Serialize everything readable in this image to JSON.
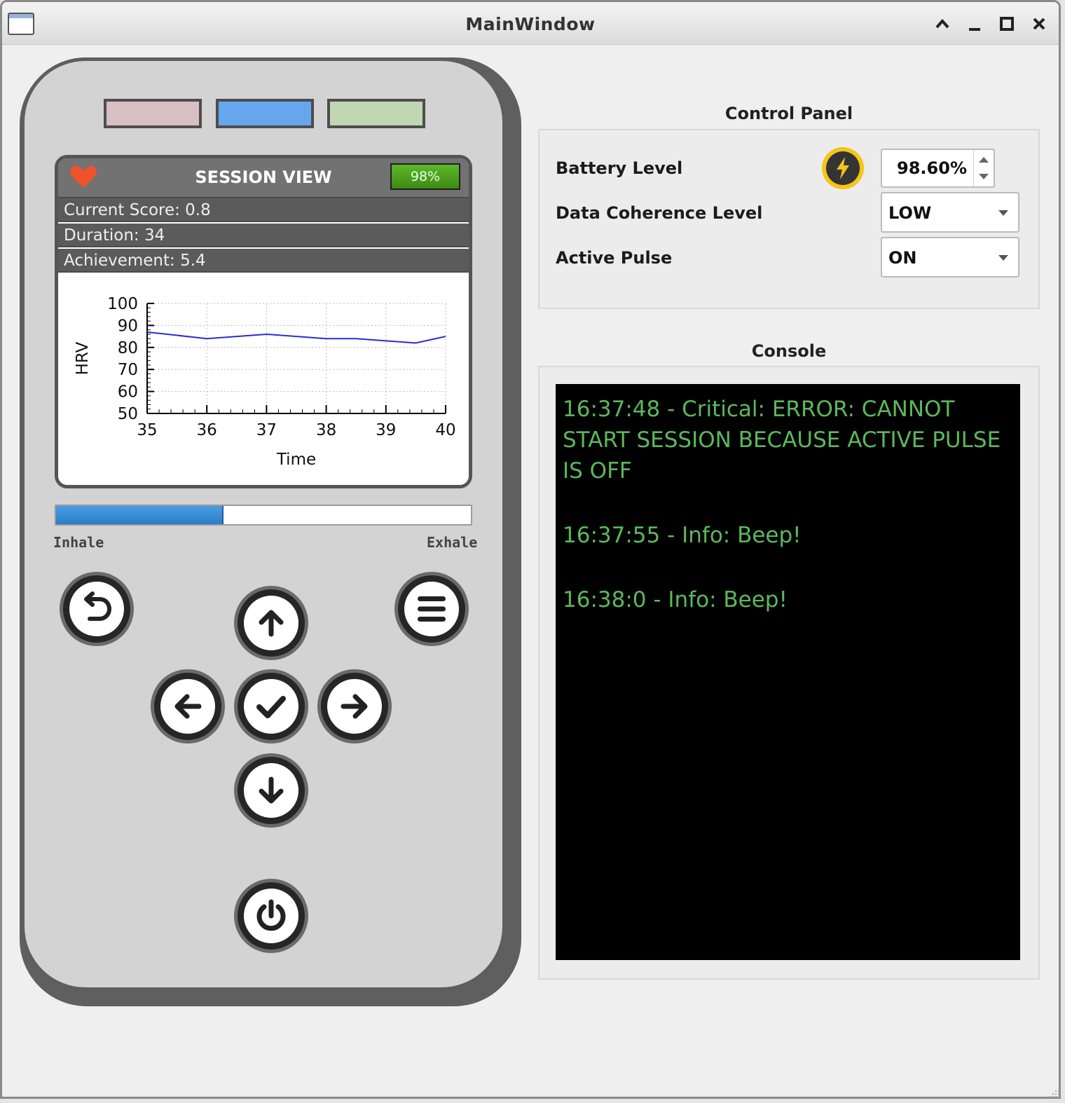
{
  "window": {
    "title": "MainWindow"
  },
  "device": {
    "leds": [
      {
        "color": "#d8bfc1"
      },
      {
        "color": "#66a6ee"
      },
      {
        "color": "#bfd7b2"
      }
    ],
    "screen": {
      "title": "SESSION VIEW",
      "battery_badge": "98%",
      "current_score": "Current Score: 0.8",
      "duration": "Duration: 34",
      "achievement": "Achievement: 5.4"
    },
    "breath": {
      "inhale_label": "Inhale",
      "exhale_label": "Exhale",
      "progress": 0.4
    }
  },
  "chart_data": {
    "type": "line",
    "xlabel": "Time",
    "ylabel": "HRV",
    "xlim": [
      35,
      40
    ],
    "ylim": [
      50,
      100
    ],
    "x_ticks": [
      "35",
      "36",
      "37",
      "38",
      "39",
      "40"
    ],
    "y_ticks": [
      "50",
      "60",
      "70",
      "80",
      "90",
      "100"
    ],
    "grid": true,
    "series": [
      {
        "color": "#2b2bd6",
        "x": [
          35,
          36,
          37,
          38,
          38.5,
          39,
          39.5,
          40
        ],
        "y": [
          87,
          84,
          86,
          84,
          84,
          83,
          82,
          85
        ]
      }
    ]
  },
  "control_panel": {
    "title": "Control Panel",
    "battery_label": "Battery Level",
    "battery_value": "98.60%",
    "coherence_label": "Data Coherence Level",
    "coherence_value": "LOW",
    "pulse_label": "Active Pulse",
    "pulse_value": "ON"
  },
  "console": {
    "title": "Console",
    "lines": [
      "16:37:48 - Critical: ERROR: CANNOT START SESSION BECAUSE ACTIVE PULSE IS OFF",
      "16:37:55 - Info: Beep!",
      "16:38:0 - Info: Beep!"
    ]
  }
}
